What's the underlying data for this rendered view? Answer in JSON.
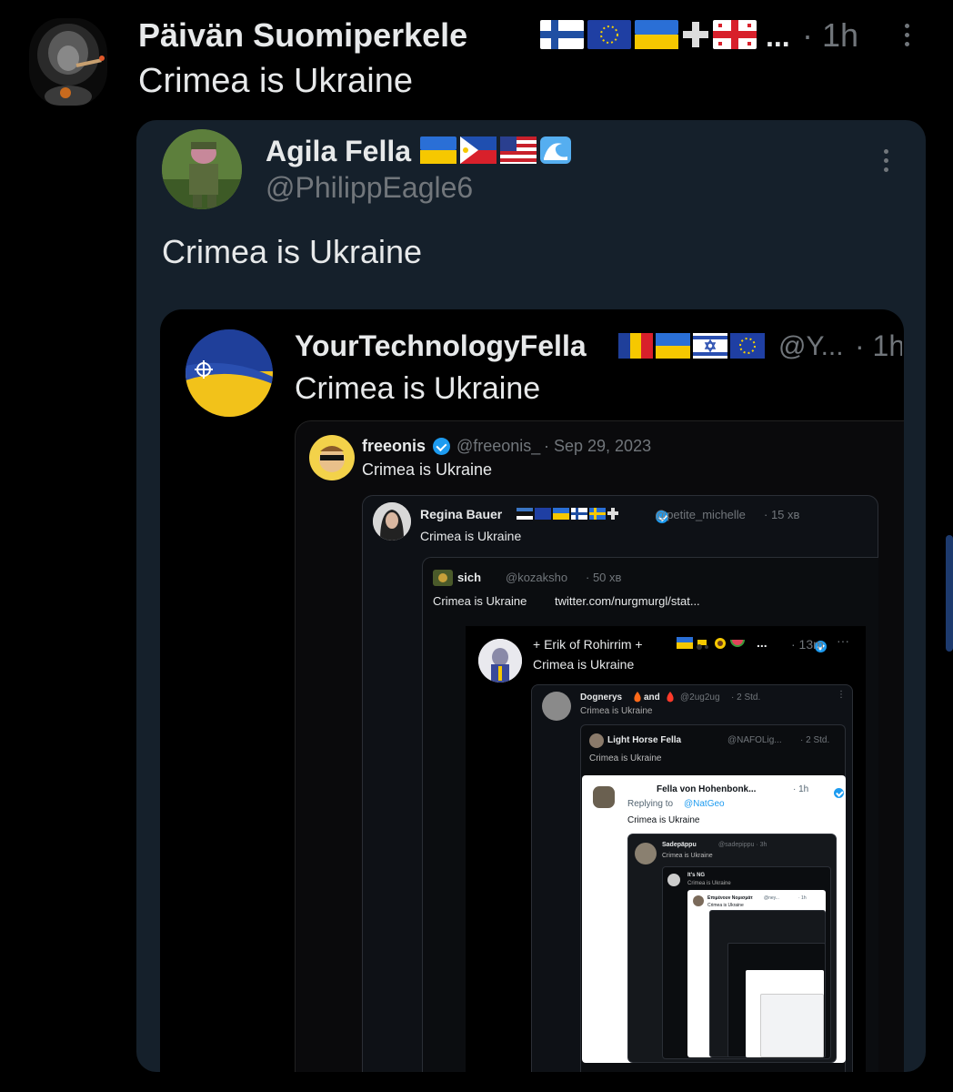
{
  "colors": {
    "background": "#000000",
    "card": "#15202b",
    "card_inner": "#0e0f12",
    "text": "#e7e9ea",
    "muted": "#71767b",
    "accent": "#1d9bf0"
  },
  "main_post": {
    "display_name": "Päivän Suomiperkele",
    "flags": [
      "finland-flag",
      "eu-flag",
      "ukraine-flag",
      "cross-icon",
      "georgia-flag"
    ],
    "ellipsis": "...",
    "time": "· 1h",
    "text": "Crimea is Ukraine",
    "avatar_icon": "lion-icon"
  },
  "quote_1": {
    "display_name": "Agila Fella",
    "flags": [
      "ukraine-flag",
      "philippines-flag",
      "usa-flag",
      "wave-icon"
    ],
    "handle": "@PhilippEagle6",
    "text": "Crimea is Ukraine",
    "avatar_icon": "soldier-icon"
  },
  "quote_2": {
    "display_name": "YourTechnologyFella",
    "flags": [
      "romania-flag",
      "ukraine-flag",
      "israel-flag",
      "eu-flag"
    ],
    "handle": "@Y...",
    "time": "· 1h",
    "text": "Crimea is Ukraine",
    "avatar_icon": "nato-ukraine-flag-icon"
  },
  "quote_3": {
    "display_name": "freeonis",
    "handle": "@freeonis_",
    "time": "· Sep 29, 2023",
    "text": "Crimea is Ukraine",
    "avatar_icon": "cartoon-sunglasses-icon"
  },
  "quote_4": {
    "display_name": "Regina Bauer",
    "handle": "@petite_michelle",
    "time": "· 15 хв",
    "text": "Crimea is Ukraine",
    "avatar_icon": "portrait-icon"
  },
  "quote_5": {
    "display_name": "sich",
    "handle": "@kozaksho",
    "time": "· 50 хв",
    "text": "Crimea is Ukraine",
    "link": "twitter.com/nurgmurgl/stat..."
  },
  "quote_6": {
    "display_name": "+ Erik of Rohirrim +",
    "time": "· 13m",
    "text": "Crimea is Ukraine",
    "avatar_icon": "knight-icon"
  },
  "quote_7": {
    "display_name": "Dognerys",
    "name_suffix": "and",
    "handle": "@2ug2ug",
    "time": "· 2 Std.",
    "text": "Crimea is Ukraine"
  },
  "quote_8": {
    "display_name": "Light Horse Fella",
    "handle": "@NAFOLig...",
    "time": "· 2 Std.",
    "text": "Crimea is Ukraine"
  },
  "quote_9": {
    "display_name": "Fella von Hohenbonk...",
    "time": "· 1h",
    "replying_prefix": "Replying to",
    "replying_handle": "@NatGeo",
    "text": "Crimea is Ukraine"
  },
  "quote_10": {
    "display_name": "Sadepäppu",
    "handle": "@sadepippu · 3h",
    "text": "Crimea is Ukraine"
  },
  "quote_11": {
    "display_name": "It's NG",
    "text": "Crimea is Ukraine"
  },
  "quote_12": {
    "display_name": "Επιμένουν Νομισμάτ",
    "handle": "@ney...",
    "time": "· 1h",
    "text": "Crimea is Ukraine"
  }
}
